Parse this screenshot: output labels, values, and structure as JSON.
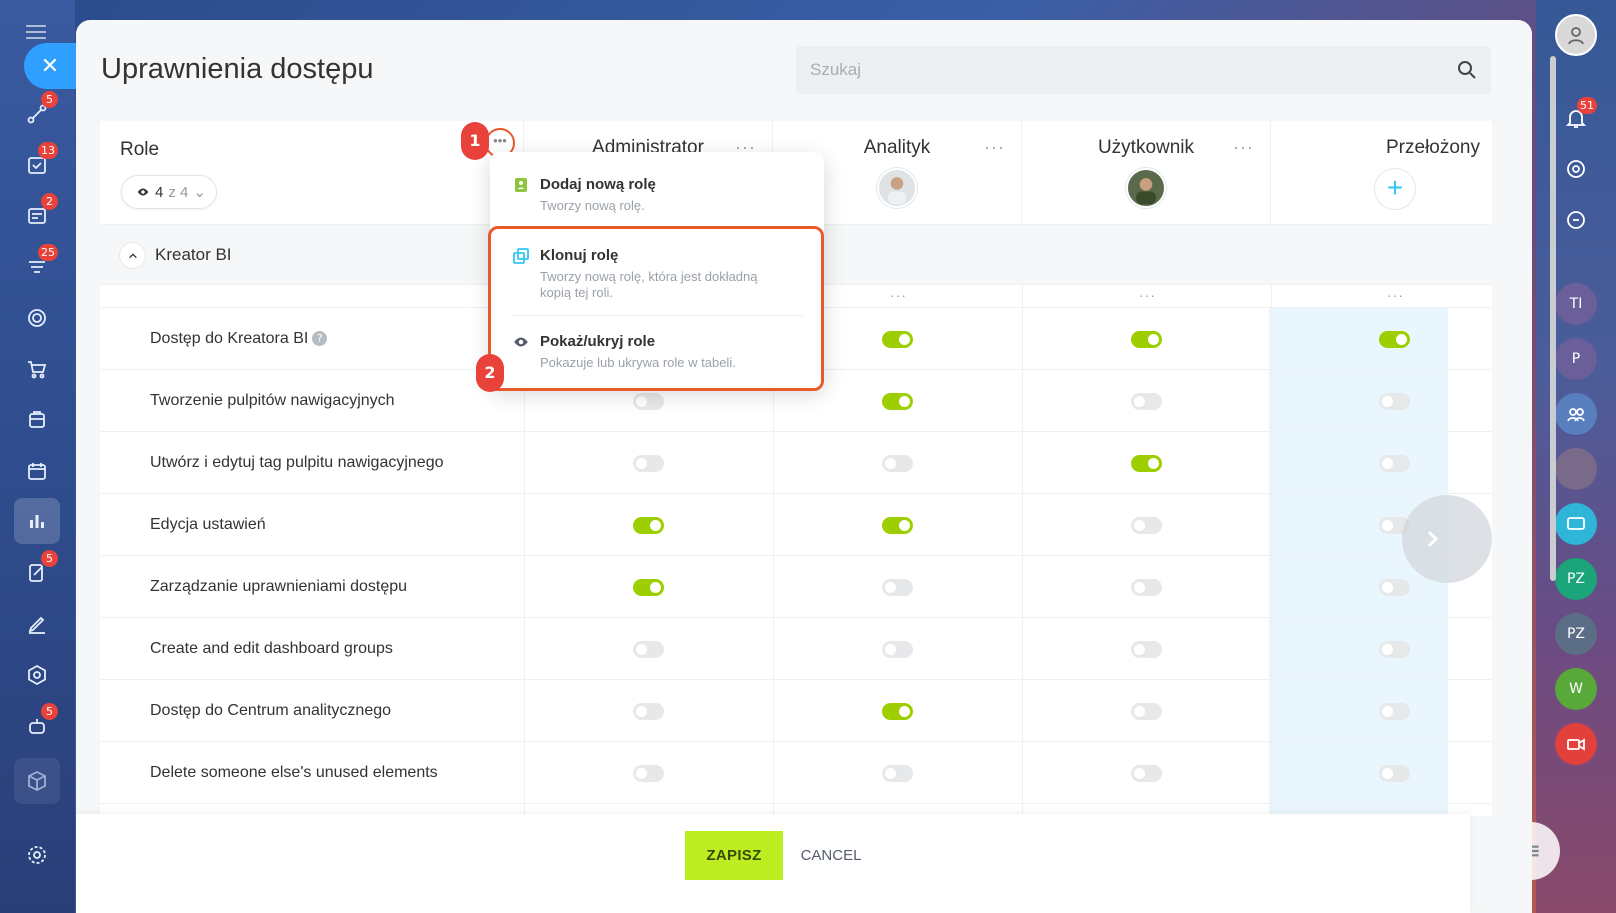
{
  "page": {
    "title": "Uprawnienia dostępu"
  },
  "search": {
    "placeholder": "Szukaj"
  },
  "left_sidebar": {
    "badges": {
      "flows": "5",
      "tasks": "13",
      "news": "2",
      "feed": "25",
      "sign": "5",
      "bot": "5"
    }
  },
  "right_rail": {
    "notifications_badge": "51",
    "avatars": [
      "TI",
      "P",
      "PZ",
      "PZ",
      "W"
    ]
  },
  "table": {
    "roles_header": "Role",
    "role_filter": {
      "count": "4",
      "of": "z 4"
    },
    "section_title": "Kreator BI",
    "columns": [
      {
        "title": "Administrator"
      },
      {
        "title": "Analityk"
      },
      {
        "title": "Użytkownik"
      },
      {
        "title": "Przełożony"
      }
    ],
    "rows": [
      {
        "label": "Dostęp do Kreatora BI",
        "values": [
          true,
          true,
          true,
          true
        ]
      },
      {
        "label": "Tworzenie pulpitów nawigacyjnych",
        "values": [
          false,
          true,
          false,
          false
        ]
      },
      {
        "label": "Utwórz i edytuj tag pulpitu nawigacyjnego",
        "values": [
          false,
          false,
          true,
          false
        ]
      },
      {
        "label": "Edycja ustawień",
        "values": [
          true,
          true,
          false,
          false
        ]
      },
      {
        "label": "Zarządzanie uprawnieniami dostępu",
        "values": [
          true,
          false,
          false,
          false
        ]
      },
      {
        "label": "Create and edit dashboard groups",
        "values": [
          false,
          false,
          false,
          false
        ]
      },
      {
        "label": "Dostęp do Centrum analitycznego",
        "values": [
          false,
          true,
          false,
          false
        ]
      },
      {
        "label": "Delete someone else's unused elements",
        "values": [
          false,
          false,
          false,
          false
        ]
      }
    ]
  },
  "menu": {
    "items": [
      {
        "title": "Dodaj nową rolę",
        "desc": "Tworzy nową rolę."
      },
      {
        "title": "Klonuj rolę",
        "desc": "Tworzy nową rolę, która jest dokładną kopią tej roli."
      },
      {
        "title": "Pokaż/ukryj role",
        "desc": "Pokazuje lub ukrywa role w tabeli."
      }
    ]
  },
  "annotations": {
    "step1": "1",
    "step2": "2"
  },
  "footer": {
    "save_label": "ZAPISZ",
    "cancel_label": "CANCEL"
  },
  "colors": {
    "toggle_on": "#9dcf00",
    "save": "#bbed21",
    "highlight": "#e95a2b",
    "badge": "#e9423a"
  }
}
